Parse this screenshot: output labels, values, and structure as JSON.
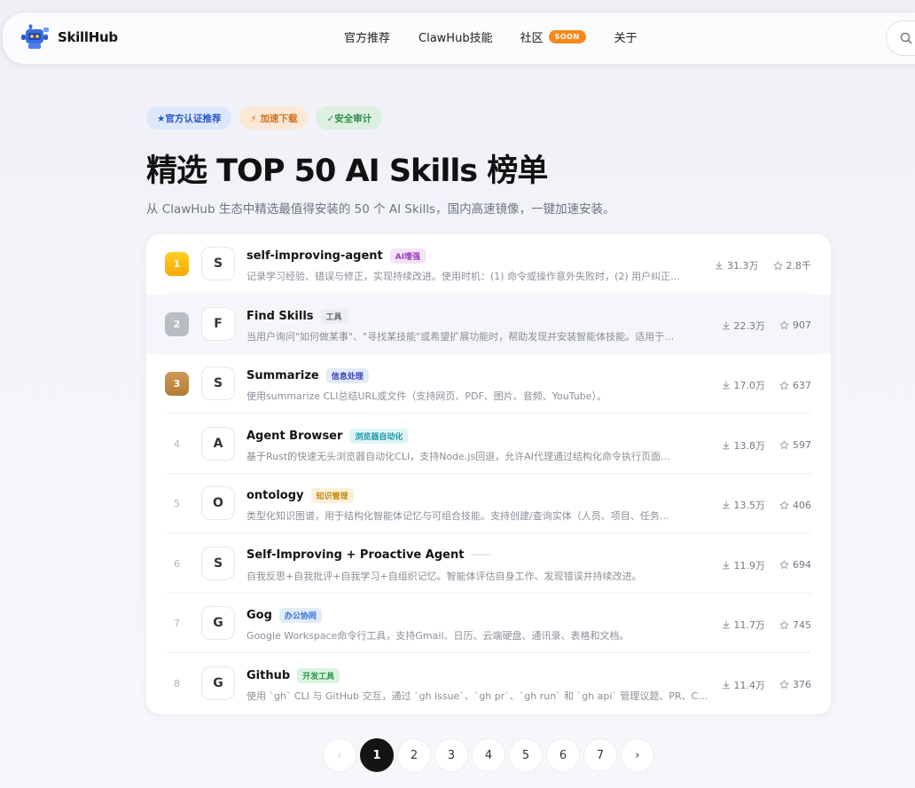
{
  "header": {
    "brand": "SkillHub",
    "nav": [
      {
        "label": "官方推荐"
      },
      {
        "label": "ClawHub技能"
      },
      {
        "label": "社区",
        "badge": "SOON"
      },
      {
        "label": "关于"
      }
    ]
  },
  "hero": {
    "badges": [
      {
        "label": "★官方认证推荐"
      },
      {
        "label": "⚡ 加速下载"
      },
      {
        "label": "✓安全审计"
      }
    ],
    "title": "精选 TOP 50 AI Skills 榜单",
    "subtitle": "从 ClawHub 生态中精选最值得安装的 50 个 AI Skills，国内高速镜像，一键加速安装。"
  },
  "skills": [
    {
      "rank": "1",
      "avatar": "S",
      "name": "self-improving-agent",
      "tag": "AI增强",
      "tag_color": "#9c3bb8",
      "tag_bg": "#f3e4f8",
      "desc": "记录学习经验、错误与修正，实现持续改进。使用时机：(1) 命令或操作意外失败时，(2) 用户纠正…",
      "downloads": "31.3万",
      "stars": "2.8千"
    },
    {
      "rank": "2",
      "avatar": "F",
      "name": "Find Skills",
      "tag": "工具",
      "tag_color": "#666a73",
      "tag_bg": "#eceef1",
      "desc": "当用户询问\"如何做某事\"、\"寻找某技能\"或希望扩展功能时，帮助发现并安装智能体技能。适用于…",
      "downloads": "22.3万",
      "stars": "907"
    },
    {
      "rank": "3",
      "avatar": "S",
      "name": "Summarize",
      "tag": "信息处理",
      "tag_color": "#3848b8",
      "tag_bg": "#e5e9fa",
      "desc": "使用summarize CLI总结URL或文件（支持网页、PDF、图片、音频、YouTube）。",
      "downloads": "17.0万",
      "stars": "637"
    },
    {
      "rank": "4",
      "avatar": "A",
      "name": "Agent Browser",
      "tag": "浏览器自动化",
      "tag_color": "#1f9aa8",
      "tag_bg": "#dff4f6",
      "desc": "基于Rust的快速无头浏览器自动化CLI，支持Node.js回退，允许AI代理通过结构化命令执行页面…",
      "downloads": "13.8万",
      "stars": "597"
    },
    {
      "rank": "5",
      "avatar": "O",
      "name": "ontology",
      "tag": "知识管理",
      "tag_color": "#c78a12",
      "tag_bg": "#fbf1d9",
      "desc": "类型化知识图谱，用于结构化智能体记忆与可组合技能。支持创建/查询实体（人员、项目、任务…",
      "downloads": "13.5万",
      "stars": "406"
    },
    {
      "rank": "6",
      "avatar": "S",
      "name": "Self-Improving + Proactive Agent",
      "tag": "",
      "tag_color": "#999",
      "tag_bg": "#e7e8ec",
      "desc": "自我反思+自我批评+自我学习+自组织记忆。智能体评估自身工作、发现错误并持续改进。",
      "downloads": "11.9万",
      "stars": "694"
    },
    {
      "rank": "7",
      "avatar": "G",
      "name": "Gog",
      "tag": "办公协同",
      "tag_color": "#2f6fd8",
      "tag_bg": "#e2ecfb",
      "desc": "Google Workspace命令行工具，支持Gmail、日历、云端硬盘、通讯录、表格和文档。",
      "downloads": "11.7万",
      "stars": "745"
    },
    {
      "rank": "8",
      "avatar": "G",
      "name": "Github",
      "tag": "开发工具",
      "tag_color": "#2e9448",
      "tag_bg": "#ddf2e2",
      "desc": "使用 `gh` CLI 与 GitHub 交互，通过 `gh issue`、`gh pr`、`gh run` 和 `gh api` 管理议题、PR、CI…",
      "downloads": "11.4万",
      "stars": "376"
    }
  ],
  "pagination": {
    "prev": "‹",
    "pages": [
      "1",
      "2",
      "3",
      "4",
      "5",
      "6",
      "7"
    ],
    "active": "1",
    "next": "›"
  }
}
